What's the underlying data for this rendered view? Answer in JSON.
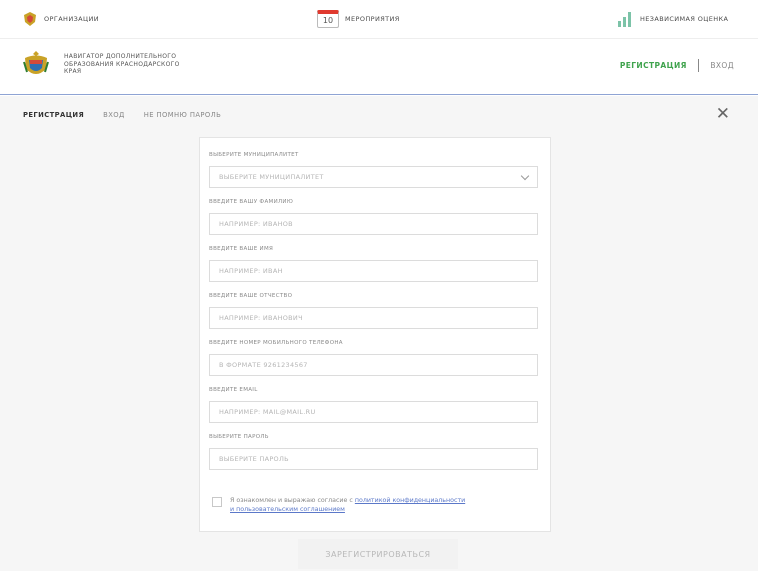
{
  "topbar": {
    "organizations": "ОРГАНИЗАЦИИ",
    "calendar_day": "10",
    "events": "МЕРОПРИЯТИЯ",
    "independent_assessment": "НЕЗАВИСИМАЯ ОЦЕНКА"
  },
  "header": {
    "brand_line1": "НАВИГАТОР ДОПОЛНИТЕЛЬНОГО",
    "brand_line2": "ОБРАЗОВАНИЯ КРАСНОДАРСКОГО",
    "brand_line3": "КРАЯ",
    "register": "РЕГИСТРАЦИЯ",
    "login": "ВХОД"
  },
  "tabs": [
    {
      "label": "РЕГИСТРАЦИЯ",
      "active": true
    },
    {
      "label": "ВХОД",
      "active": false
    },
    {
      "label": "НЕ ПОМНЮ ПАРОЛЬ",
      "active": false
    }
  ],
  "form": {
    "fields": [
      {
        "label": "ВЫБЕРИТЕ МУНИЦИПАЛИТЕТ",
        "placeholder": "ВЫБЕРИТЕ МУНИЦИПАЛИТЕТ",
        "type": "select"
      },
      {
        "label": "ВВЕДИТЕ ВАШУ ФАМИЛИЮ",
        "placeholder": "НАПРИМЕР: ИВАНОВ",
        "type": "text"
      },
      {
        "label": "ВВЕДИТЕ ВАШЕ ИМЯ",
        "placeholder": "НАПРИМЕР: ИВАН",
        "type": "text"
      },
      {
        "label": "ВВЕДИТЕ ВАШЕ ОТЧЕСТВО",
        "placeholder": "НАПРИМЕР: ИВАНОВИЧ",
        "type": "text"
      },
      {
        "label": "ВВЕДИТЕ НОМЕР МОБИЛЬНОГО ТЕЛЕФОНА",
        "placeholder": "В ФОРМАТЕ 9261234567",
        "type": "text"
      },
      {
        "label": "ВВЕДИТЕ EMAIL",
        "placeholder": "НАПРИМЕР: MAIL@MAIL.RU",
        "type": "text"
      },
      {
        "label": "ВЫБЕРИТЕ ПАРОЛЬ",
        "placeholder": "ВЫБЕРИТЕ ПАРОЛЬ",
        "type": "password"
      }
    ],
    "consent_text": "Я ознакомлен и выражаю согласие с ",
    "consent_link1": "политикой конфиденциальности",
    "consent_and": " ",
    "consent_link2": "и пользовательским соглашением",
    "submit": "ЗАРЕГИСТРИРОВАТЬСЯ"
  },
  "colors": {
    "accent_green": "#3fa34d",
    "link_blue": "#5b78c9",
    "calendar_red": "#e03a2f",
    "header_border": "#8fa4d4"
  },
  "icons": {
    "close": "close-icon",
    "organizations": "crest-icon",
    "events": "calendar-icon",
    "assessment": "bar-chart-icon",
    "select_arrow": "chevron-down-icon"
  }
}
